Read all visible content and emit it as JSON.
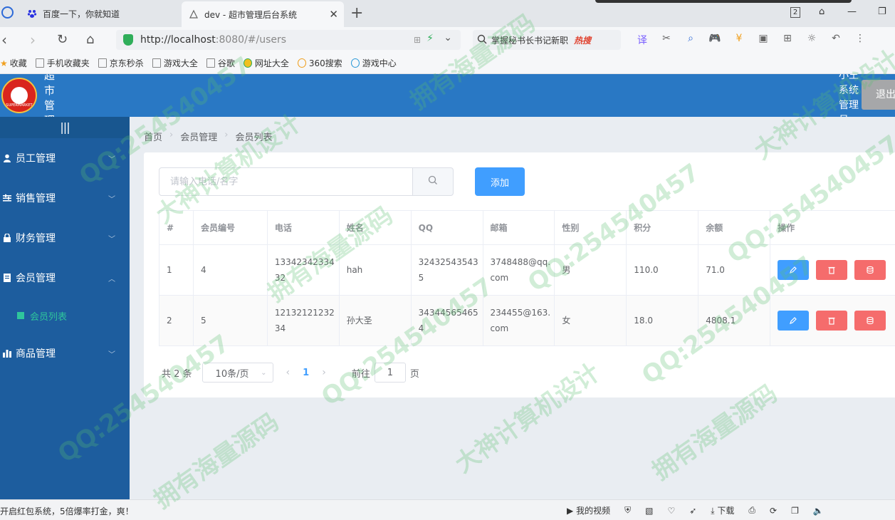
{
  "browser": {
    "tabs": [
      {
        "title": "百度一下，你就知道"
      },
      {
        "title": "dev - 超市管理后台系统"
      }
    ],
    "window_badge": "2",
    "url_host": "http://localhost",
    "url_path": ":8080/#/users",
    "search_text": "掌握秘书长书记新职",
    "search_hot": "热搜",
    "bookmarks": [
      "收藏",
      "手机收藏夹",
      "京东秒杀",
      "游戏大全",
      "谷歌",
      "网址大全",
      "360搜索",
      "游戏中心"
    ]
  },
  "header": {
    "logo_text": "SUPERMARKET",
    "title": "超市管理系统",
    "user": "小王 系统管理员",
    "logout": "退出"
  },
  "sidebar": {
    "collapse": "|||",
    "items": [
      {
        "label": "员工管理",
        "icon": "user-icon",
        "arrow": "﹀"
      },
      {
        "label": "销售管理",
        "icon": "sliders-icon",
        "arrow": "﹀"
      },
      {
        "label": "财务管理",
        "icon": "lock-icon",
        "arrow": "﹀"
      },
      {
        "label": "会员管理",
        "icon": "document-icon",
        "arrow": "︿"
      }
    ],
    "sub_item": "会员列表",
    "last_item": {
      "label": "商品管理",
      "icon": "chart-icon",
      "arrow": "﹀"
    }
  },
  "breadcrumb": [
    "首页",
    "会员管理",
    "会员列表"
  ],
  "toolbar": {
    "search_placeholder": "请输入电话/名字",
    "add_label": "添加"
  },
  "table": {
    "headers": [
      "#",
      "会员编号",
      "电话",
      "姓名",
      "QQ",
      "邮箱",
      "性别",
      "积分",
      "余额",
      "操作"
    ],
    "rows": [
      {
        "idx": "1",
        "no": "4",
        "phone": "1334234233432",
        "name": "hah",
        "qq": "324325435435",
        "email": "3748488@qq.com",
        "gender": "男",
        "points": "110.0",
        "balance": "71.0"
      },
      {
        "idx": "2",
        "no": "5",
        "phone": "1213212123234",
        "name": "孙大圣",
        "qq": "343445654654",
        "email": "234455@163.com",
        "gender": "女",
        "points": "18.0",
        "balance": "4808.1"
      }
    ]
  },
  "pagination": {
    "total": "共 2 条",
    "page_size": "10条/页",
    "current": "1",
    "goto_label": "前往",
    "goto_value": "1",
    "page_unit": "页"
  },
  "statusbar": {
    "ad": "开启红包系统，5倍爆率打金，爽！",
    "video": "我的视频",
    "download": "下载"
  },
  "watermarks": [
    "QQ:254540457",
    "大神计算机设计",
    "拥有海量源码"
  ],
  "colors": {
    "header": "#2978c4",
    "sidebar": "#1d5d9e",
    "primary": "#409eff",
    "danger": "#f56c6c",
    "active_sub": "#2fc59c"
  }
}
